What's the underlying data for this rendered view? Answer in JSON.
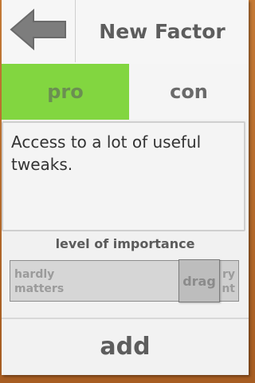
{
  "header": {
    "title": "New Factor",
    "back_icon": "arrow-left-icon"
  },
  "tabs": [
    {
      "label": "pro",
      "selected": true
    },
    {
      "label": "con",
      "selected": false
    }
  ],
  "description": {
    "value": "Access to a lot of useful tweaks."
  },
  "importance": {
    "label": "level of importance",
    "left_label_line1": "hardly",
    "left_label_line2": "matters",
    "right_label_line1": "ry",
    "right_label_line2": "nt",
    "handle_label": "drag",
    "level": 0.74
  },
  "actions": {
    "add_label": "add"
  },
  "colors": {
    "pro_tab": "#82d640",
    "frame": "#b96d2c"
  }
}
